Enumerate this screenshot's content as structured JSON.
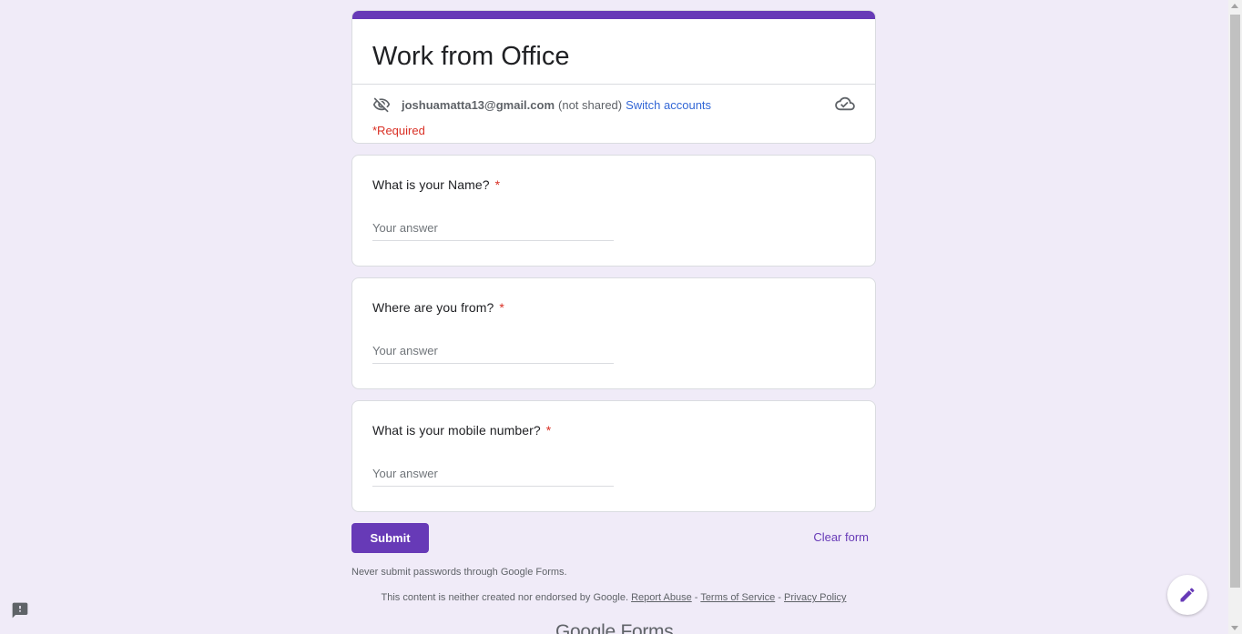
{
  "form": {
    "title": "Work from Office",
    "account": {
      "email": "joshuamatta13@gmail.com",
      "shared_status": "(not shared)",
      "switch_label": "Switch accounts"
    },
    "required_note": "*Required"
  },
  "questions": [
    {
      "label": "What is your Name?",
      "required_mark": "*",
      "placeholder": "Your answer"
    },
    {
      "label": "Where are you from?",
      "required_mark": "*",
      "placeholder": "Your answer"
    },
    {
      "label": "What is your mobile number?",
      "required_mark": "*",
      "placeholder": "Your answer"
    }
  ],
  "actions": {
    "submit_label": "Submit",
    "clear_label": "Clear form"
  },
  "footer": {
    "password_warning": "Never submit passwords through Google Forms.",
    "disclaimer": "This content is neither created nor endorsed by Google.",
    "report_abuse": "Report Abuse",
    "sep1": " - ",
    "terms": "Terms of Service",
    "sep2": " - ",
    "privacy": "Privacy Policy",
    "brand": "Google Forms"
  },
  "icons": {
    "hidden_eye": "visibility-off-icon",
    "cloud": "cloud-done-icon",
    "report": "report-icon",
    "edit": "pencil-icon"
  },
  "colors": {
    "accent": "#673ab7",
    "background": "#f0ebf8",
    "required": "#d93025",
    "link": "#3367d6"
  }
}
